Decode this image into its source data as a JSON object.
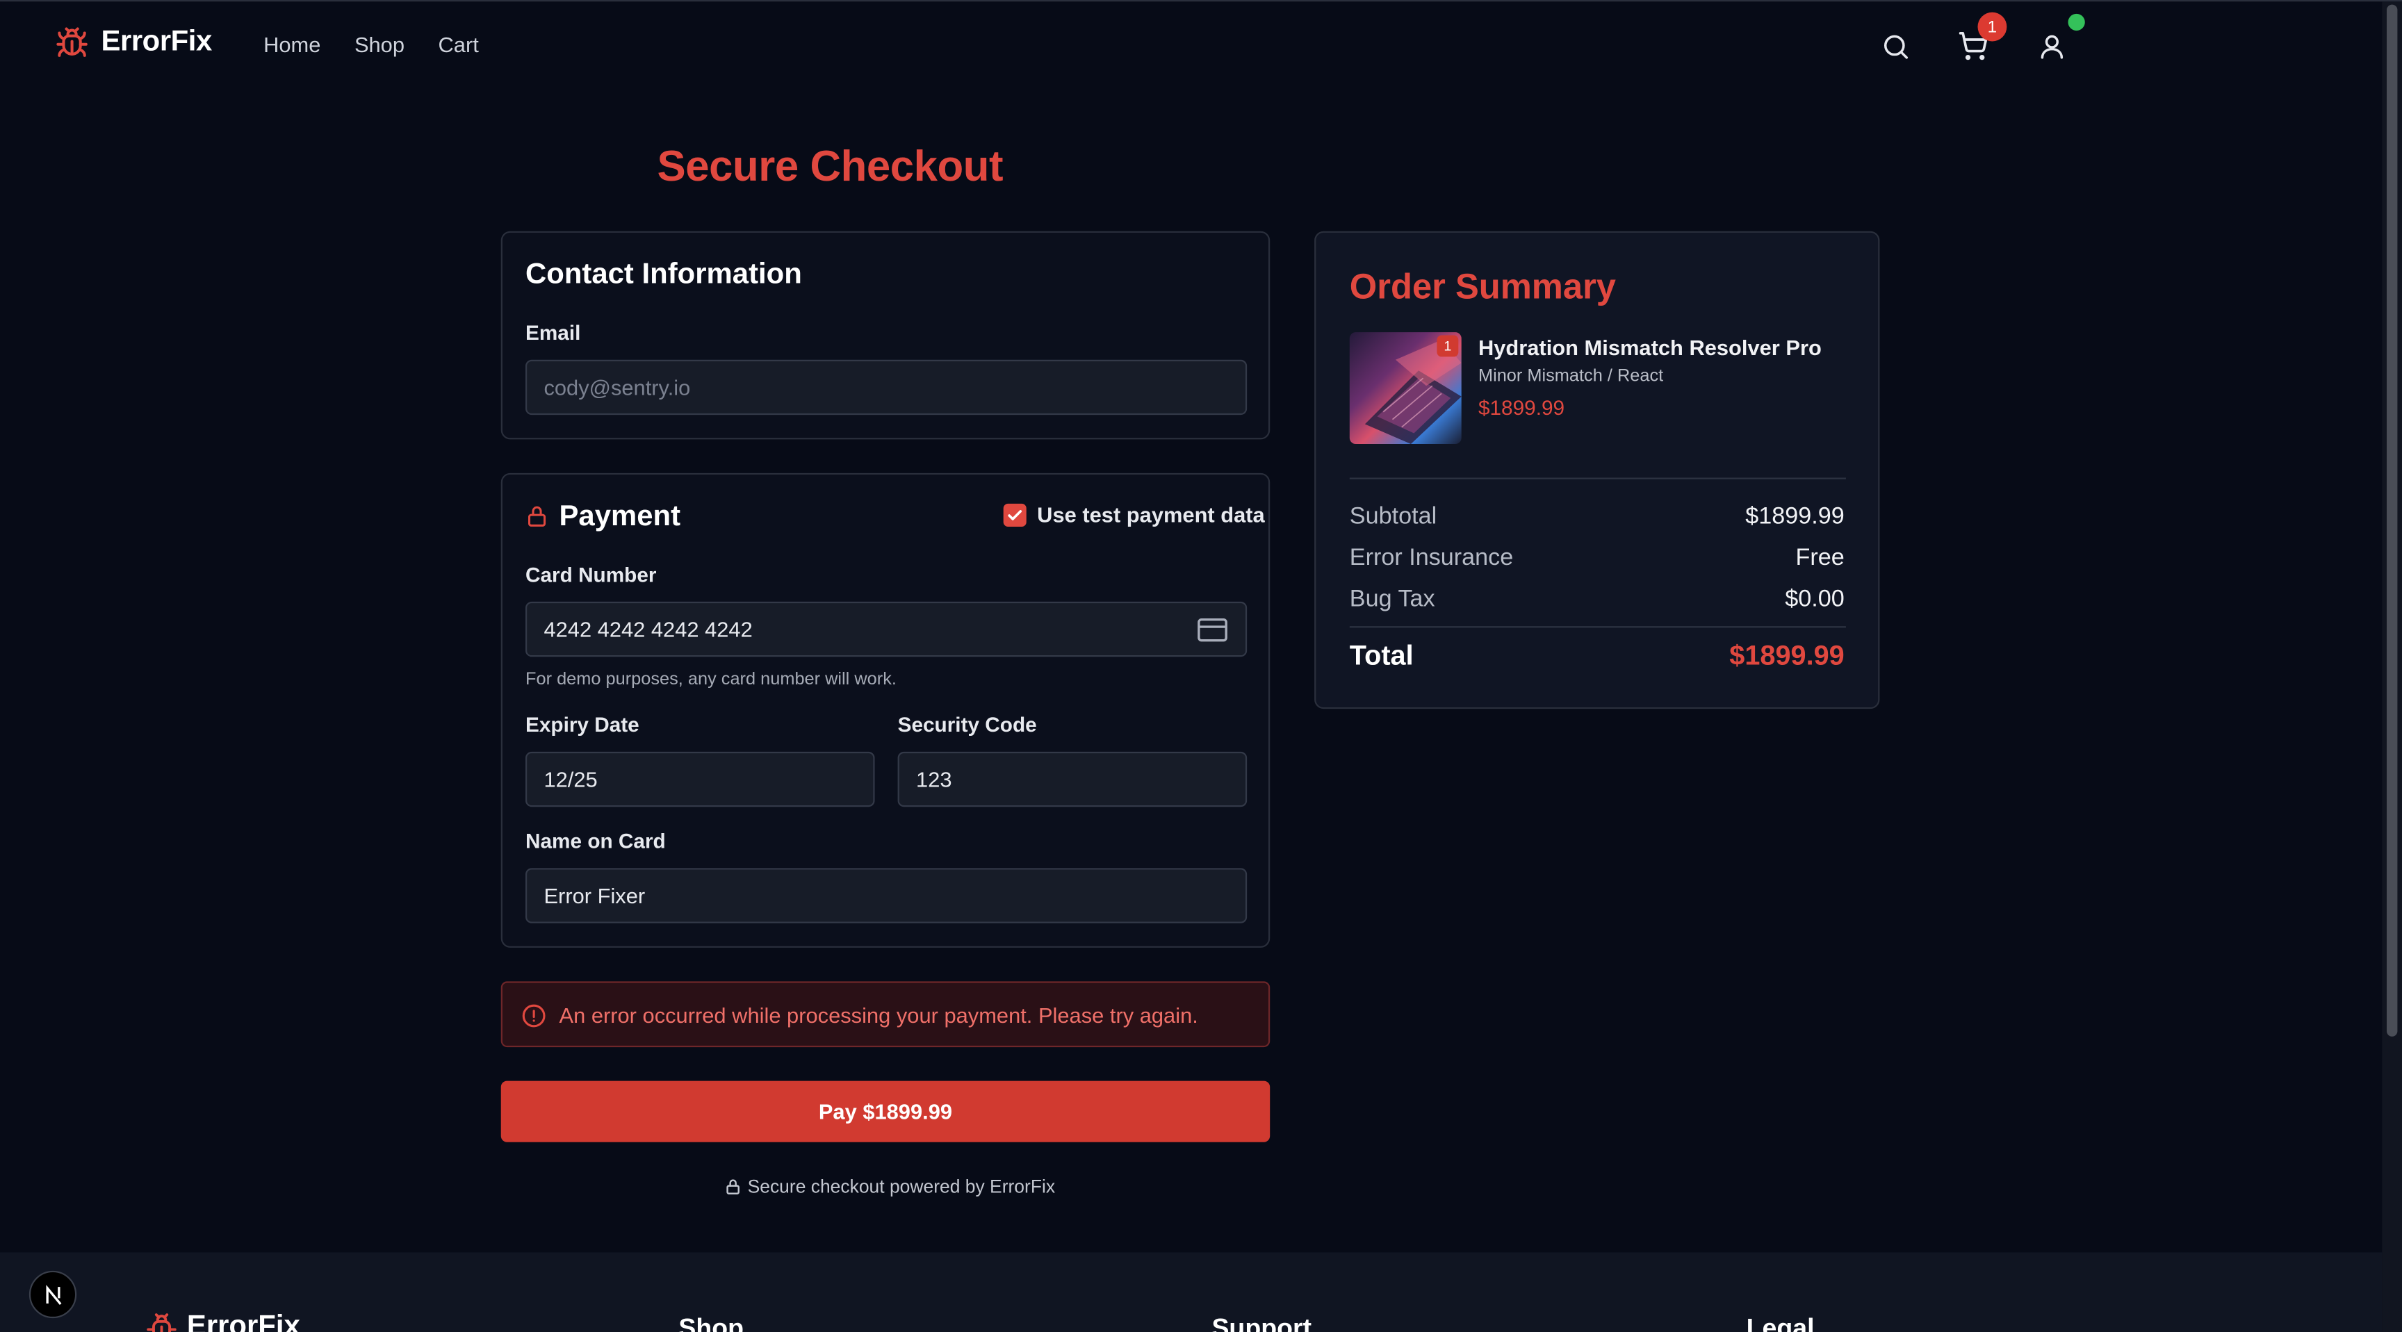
{
  "brand": {
    "name": "ErrorFix",
    "icon": "bug-icon"
  },
  "nav": {
    "items": [
      "Home",
      "Shop",
      "Cart"
    ]
  },
  "header": {
    "cart_count": "1"
  },
  "page": {
    "title": "Secure Checkout"
  },
  "contact": {
    "heading": "Contact Information",
    "email_label": "Email",
    "email_placeholder": "cody@sentry.io"
  },
  "payment": {
    "heading": "Payment",
    "use_test_label": "Use test payment data",
    "use_test_checked": true,
    "card_label": "Card Number",
    "card_value": "4242 4242 4242 4242",
    "card_hint": "For demo purposes, any card number will work.",
    "expiry_label": "Expiry Date",
    "expiry_value": "12/25",
    "cvc_label": "Security Code",
    "cvc_value": "123",
    "name_label": "Name on Card",
    "name_value": "Error Fixer"
  },
  "error": {
    "message": "An error occurred while processing your payment. Please try again."
  },
  "pay_button": {
    "label": "Pay $1899.99"
  },
  "secure_note": "Secure checkout powered by ErrorFix",
  "summary": {
    "title": "Order Summary",
    "item": {
      "name": "Hydration Mismatch Resolver Pro",
      "variant": "Minor Mismatch / React",
      "price": "$1899.99",
      "quantity": "1"
    },
    "subtotal_label": "Subtotal",
    "subtotal_value": "$1899.99",
    "insurance_label": "Error Insurance",
    "insurance_value": "Free",
    "tax_label": "Bug Tax",
    "tax_value": "$0.00",
    "total_label": "Total",
    "total_value": "$1899.99"
  },
  "footer": {
    "brand": "ErrorFix",
    "headings": [
      "Shop",
      "Support",
      "Legal"
    ]
  },
  "colors": {
    "accent": "#e0483f",
    "background": "#070b17",
    "status_online": "#34c15a"
  }
}
